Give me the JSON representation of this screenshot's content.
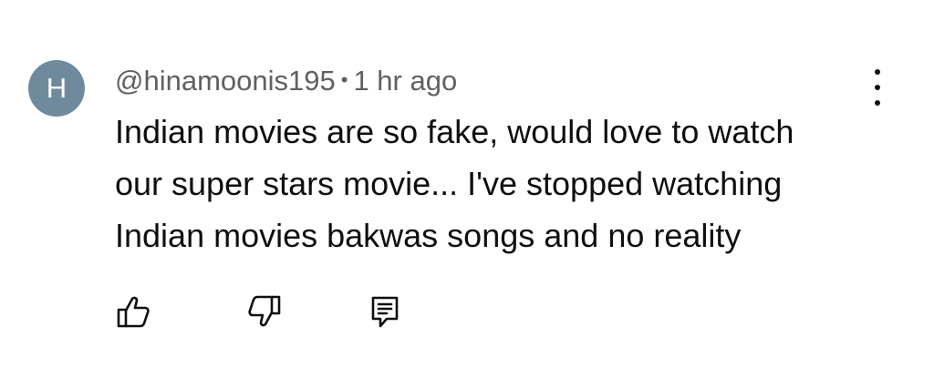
{
  "comment": {
    "avatar_initial": "H",
    "avatar_color": "#6f8a9d",
    "author": "@hinamoonis195",
    "separator": "•",
    "timestamp": "1 hr ago",
    "lines": [
      "Indian movies are so fake, would love to watch",
      "our super stars movie... I've stopped watching",
      "Indian movies bakwas songs and no reality"
    ]
  },
  "actions": {
    "menu_icon": "more-vert-icon",
    "like_icon": "thumbs-up-icon",
    "dislike_icon": "thumbs-down-icon",
    "reply_icon": "reply-comment-icon"
  }
}
